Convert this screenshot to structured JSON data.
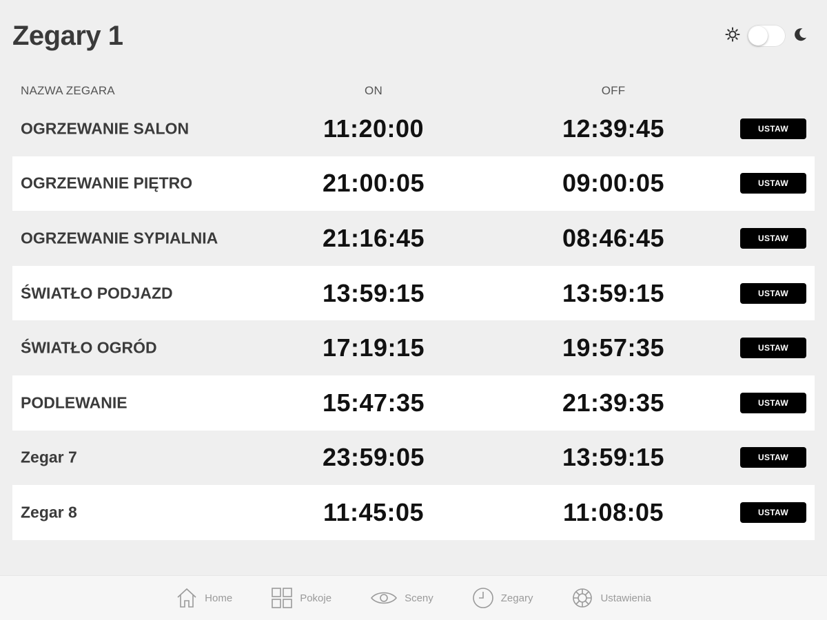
{
  "page": {
    "title": "Zegary 1"
  },
  "theme": {
    "light_icon": "sun-icon",
    "dark_icon": "moon-icon",
    "dark_mode": false
  },
  "columns": {
    "name": "NAZWA ZEGARA",
    "on": "ON",
    "off": "OFF"
  },
  "rows": [
    {
      "name": "OGRZEWANIE SALON",
      "on": "11:20:00",
      "off": "12:39:45",
      "button": "USTAW"
    },
    {
      "name": "OGRZEWANIE PIĘTRO",
      "on": "21:00:05",
      "off": "09:00:05",
      "button": "USTAW"
    },
    {
      "name": "OGRZEWANIE SYPIALNIA",
      "on": "21:16:45",
      "off": "08:46:45",
      "button": "USTAW"
    },
    {
      "name": "ŚWIATŁO PODJAZD",
      "on": "13:59:15",
      "off": "13:59:15",
      "button": "USTAW"
    },
    {
      "name": "ŚWIATŁO OGRÓD",
      "on": "17:19:15",
      "off": "19:57:35",
      "button": "USTAW"
    },
    {
      "name": "PODLEWANIE",
      "on": "15:47:35",
      "off": "21:39:35",
      "button": "USTAW"
    },
    {
      "name": "Zegar 7",
      "on": "23:59:05",
      "off": "13:59:15",
      "button": "USTAW"
    },
    {
      "name": "Zegar 8",
      "on": "11:45:05",
      "off": "11:08:05",
      "button": "USTAW"
    }
  ],
  "nav": [
    {
      "label": "Home",
      "icon": "home-icon"
    },
    {
      "label": "Pokoje",
      "icon": "grid-icon"
    },
    {
      "label": "Sceny",
      "icon": "eye-icon"
    },
    {
      "label": "Zegary",
      "icon": "clock-icon"
    },
    {
      "label": "Ustawienia",
      "icon": "settings-wheel-icon"
    }
  ],
  "colors": {
    "background": "#efefef",
    "row_alt": "#ffffff",
    "button": "#000000",
    "nav_text": "#9a9a9a"
  }
}
